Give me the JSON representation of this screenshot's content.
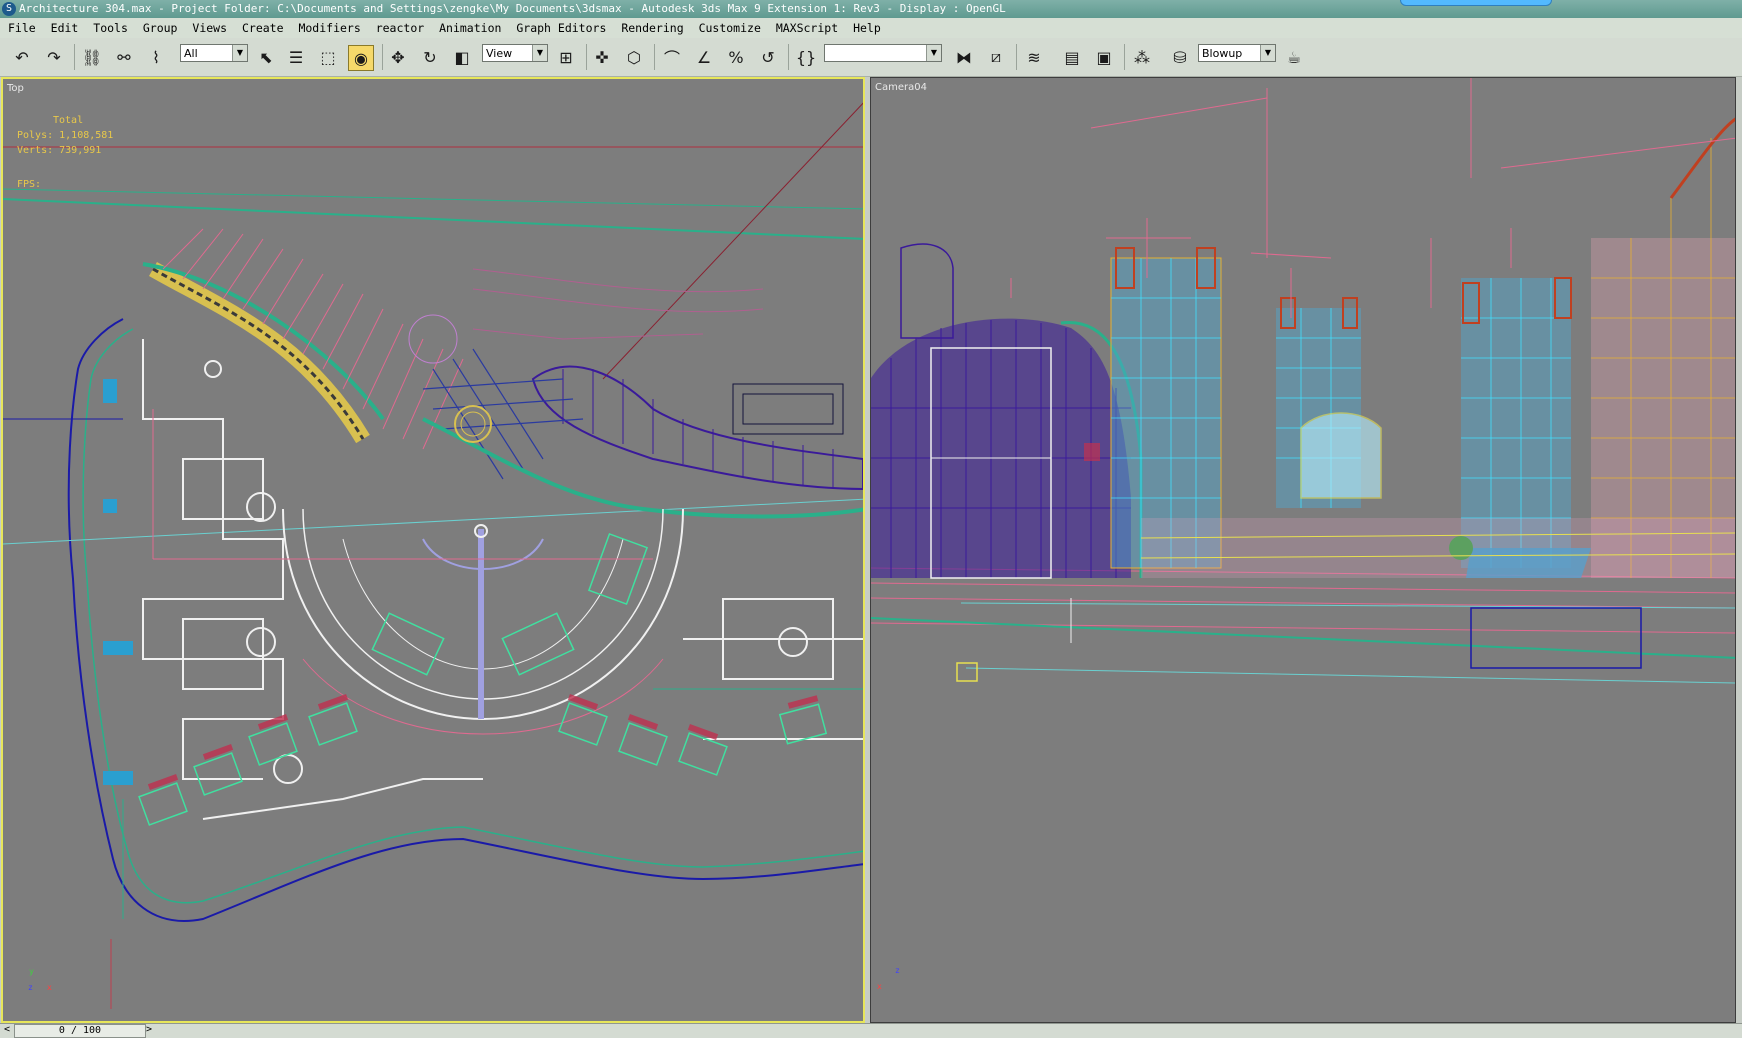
{
  "titlebar": {
    "text": "Architecture 304.max    - Project Folder: C:\\Documents and Settings\\zengke\\My Documents\\3dsmax     - Autodesk 3ds Max 9 Extension 1: Rev3        - Display : OpenGL",
    "icon": "3ds-max-app-icon"
  },
  "menu": [
    "File",
    "Edit",
    "Tools",
    "Group",
    "Views",
    "Create",
    "Modifiers",
    "reactor",
    "Animation",
    "Graph Editors",
    "Rendering",
    "Customize",
    "MAXScript",
    "Help"
  ],
  "toolbar": {
    "selection_filter": "All",
    "coord_system": "View",
    "named_selection": "",
    "render_preset": "Blowup",
    "icons": [
      "undo-icon",
      "redo-icon",
      "select-link-icon",
      "unlink-icon",
      "bind-spacewarp-icon",
      "select-object-icon",
      "select-by-name-icon",
      "rect-selection-icon",
      "window-crossing-icon",
      "move-icon",
      "rotate-icon",
      "scale-icon",
      "pivot-icon",
      "select-manipulate-icon",
      "keyboard-shortcut-icon",
      "snap-toggle-icon",
      "angle-snap-icon",
      "percent-snap-icon",
      "spinner-snap-icon",
      "edit-named-selection-icon",
      "mirror-icon",
      "align-icon",
      "layer-manager-icon",
      "curve-editor-icon",
      "schematic-view-icon",
      "material-editor-icon",
      "render-scene-icon",
      "quick-render-icon"
    ]
  },
  "viewports": {
    "left": {
      "label": "Top",
      "stats_total": "Total",
      "stats_polys": "Polys: 1,108,581",
      "stats_verts": "Verts: 739,991",
      "fps": "FPS:"
    },
    "right": {
      "label": "Camera04"
    }
  },
  "axis": {
    "x": "x",
    "y": "y",
    "z": "z"
  },
  "timeline": {
    "frame": "0 / 100",
    "prev": "<",
    "next": ">"
  },
  "colors": {
    "active_border": "#e7e65a",
    "viewport_bg": "#7d7d7d",
    "stats_text": "#e8c84a"
  }
}
